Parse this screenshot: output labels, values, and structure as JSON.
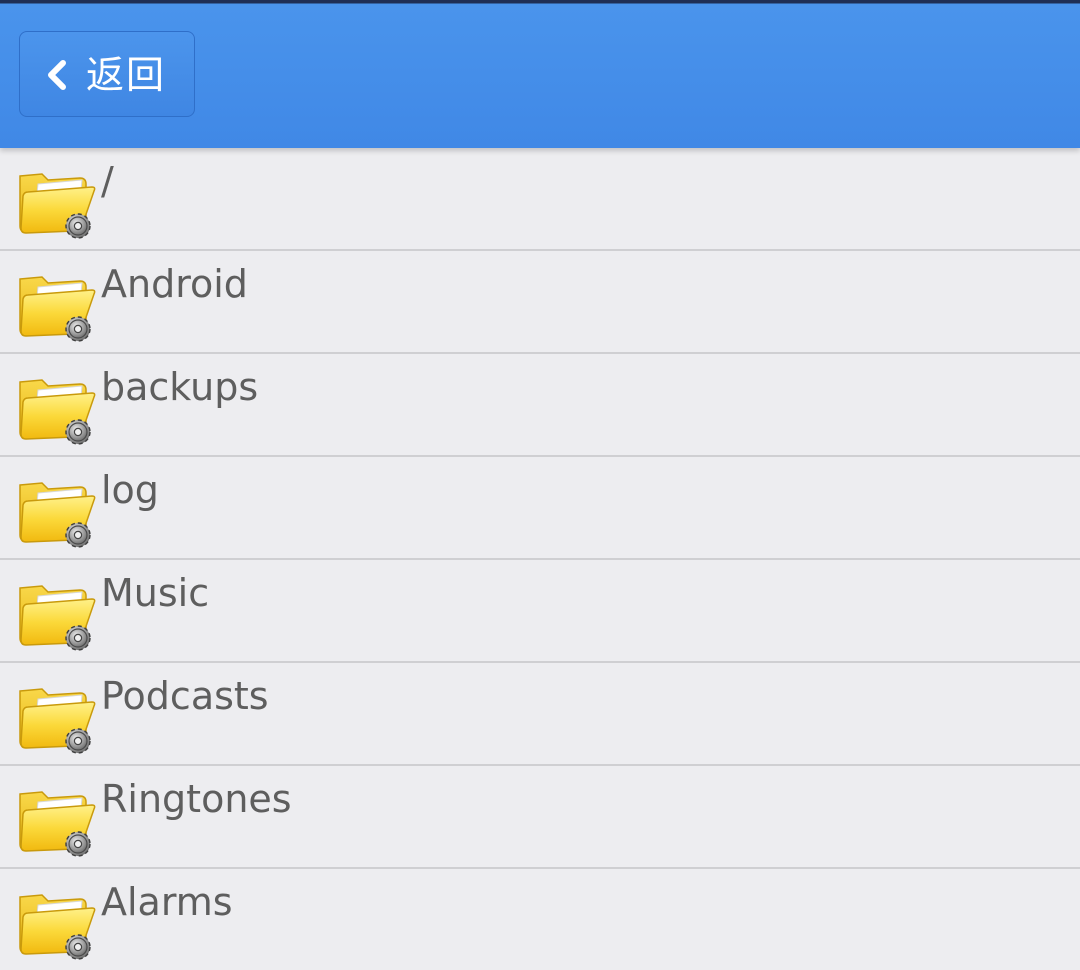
{
  "header": {
    "back_label": "返回",
    "background_color": "#4088e6"
  },
  "list": {
    "items": [
      {
        "label": "/",
        "icon": "folder-gear-icon"
      },
      {
        "label": "Android",
        "icon": "folder-gear-icon"
      },
      {
        "label": "backups",
        "icon": "folder-gear-icon"
      },
      {
        "label": "log",
        "icon": "folder-gear-icon"
      },
      {
        "label": "Music",
        "icon": "folder-gear-icon"
      },
      {
        "label": "Podcasts",
        "icon": "folder-gear-icon"
      },
      {
        "label": "Ringtones",
        "icon": "folder-gear-icon"
      },
      {
        "label": "Alarms",
        "icon": "folder-gear-icon"
      }
    ]
  },
  "colors": {
    "folder": "#f7cf2b",
    "text": "#5e5e5e",
    "divider": "#cfcfd2",
    "row_background": "#ededf0"
  }
}
